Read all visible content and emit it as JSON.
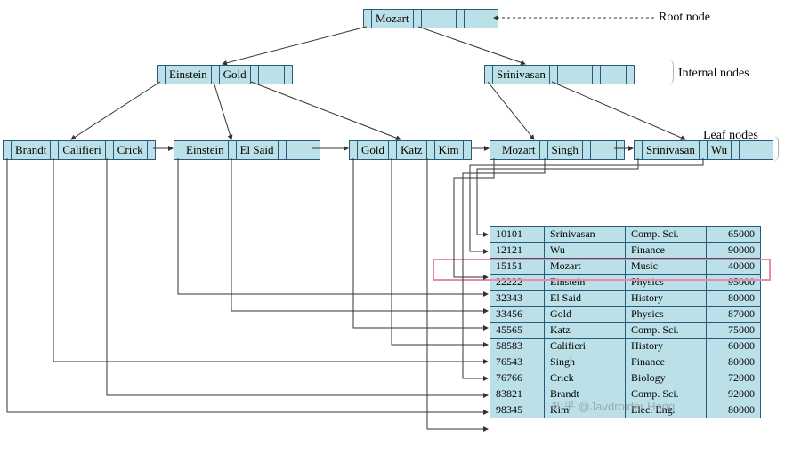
{
  "labels": {
    "root": "Root node",
    "internal": "Internal nodes",
    "leaf": "Leaf nodes"
  },
  "root": {
    "keys": [
      "Mozart"
    ]
  },
  "internal": [
    {
      "keys": [
        "Einstein",
        "Gold"
      ]
    },
    {
      "keys": [
        "Srinivasan"
      ]
    }
  ],
  "leaves": [
    {
      "keys": [
        "Brandt",
        "Califieri",
        "Crick"
      ]
    },
    {
      "keys": [
        "Einstein",
        "El Said"
      ]
    },
    {
      "keys": [
        "Gold",
        "Katz",
        "Kim"
      ]
    },
    {
      "keys": [
        "Mozart",
        "Singh"
      ]
    },
    {
      "keys": [
        "Srinivasan",
        "Wu"
      ]
    }
  ],
  "table": {
    "rows": [
      {
        "id": "10101",
        "name": "Srinivasan",
        "dept": "Comp. Sci.",
        "salary": "65000"
      },
      {
        "id": "12121",
        "name": "Wu",
        "dept": "Finance",
        "salary": "90000"
      },
      {
        "id": "15151",
        "name": "Mozart",
        "dept": "Music",
        "salary": "40000"
      },
      {
        "id": "22222",
        "name": "Einstein",
        "dept": "Physics",
        "salary": "95000"
      },
      {
        "id": "32343",
        "name": "El Said",
        "dept": "History",
        "salary": "80000"
      },
      {
        "id": "33456",
        "name": "Gold",
        "dept": "Physics",
        "salary": "87000"
      },
      {
        "id": "45565",
        "name": "Katz",
        "dept": "Comp. Sci.",
        "salary": "75000"
      },
      {
        "id": "58583",
        "name": "Califieri",
        "dept": "History",
        "salary": "60000"
      },
      {
        "id": "76543",
        "name": "Singh",
        "dept": "Finance",
        "salary": "80000"
      },
      {
        "id": "76766",
        "name": "Crick",
        "dept": "Biology",
        "salary": "72000"
      },
      {
        "id": "83821",
        "name": "Brandt",
        "dept": "Comp. Sci.",
        "salary": "92000"
      },
      {
        "id": "98345",
        "name": "Kim",
        "dept": "Elec. Eng.",
        "salary": "80000"
      }
    ],
    "highlight_index": 2
  },
  "watermark": "知乎 @Javdroider Hong"
}
